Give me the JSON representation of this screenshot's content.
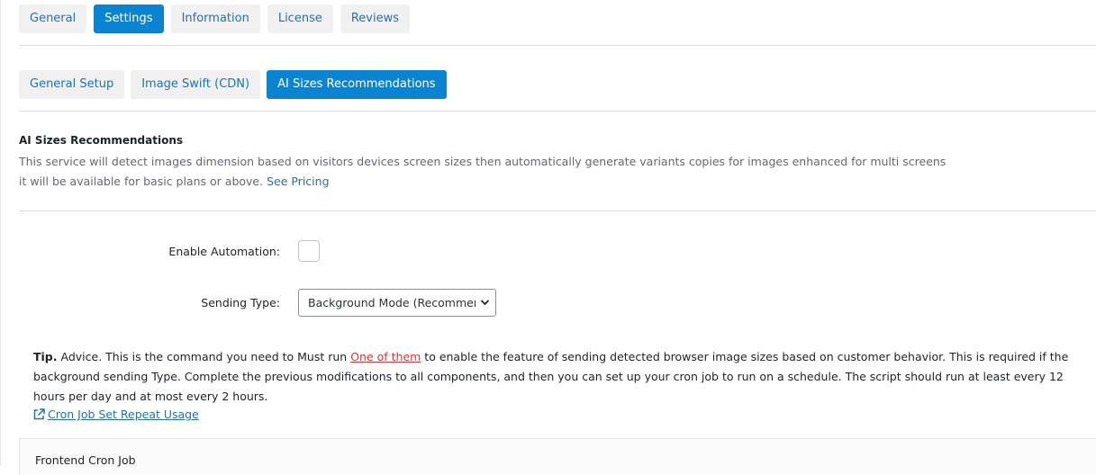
{
  "main_tabs": [
    {
      "label": "General",
      "active": false
    },
    {
      "label": "Settings",
      "active": true
    },
    {
      "label": "Information",
      "active": false
    },
    {
      "label": "License",
      "active": false
    },
    {
      "label": "Reviews",
      "active": false
    }
  ],
  "sub_tabs": [
    {
      "label": "General Setup",
      "active": false
    },
    {
      "label": "Image Swift (CDN)",
      "active": false
    },
    {
      "label": "AI Sizes Recommendations",
      "active": true
    }
  ],
  "section": {
    "title": "AI Sizes Recommendations",
    "description_line1": "This service will detect images dimension based on visitors devices screen sizes then automatically generate variants copies for images enhanced for multi screens",
    "description_line2": "it will be available for basic plans or above.",
    "pricing_link": "See Pricing"
  },
  "form": {
    "enable_automation_label": "Enable Automation:",
    "sending_type_label": "Sending Type:",
    "sending_type_value": "Background Mode (Recommended)"
  },
  "tip": {
    "label": "Tip.",
    "text_before": " Advice. This is the command you need to Must run ",
    "highlight": "One of them",
    "text_after": " to enable the feature of sending detected browser image sizes based on customer behavior. This is required if the background sending Type. Complete the previous modifications to all components, and then you can set up your cron job to run on a schedule. The script should run at least every 12 hours per day and at most every 2 hours."
  },
  "cron_link": "Cron Job Set Repeat Usage",
  "panel_title": "Frontend Cron Job",
  "icons": {
    "external_link": "external-link-icon",
    "select_chevron": "chevron-down-icon"
  },
  "colors": {
    "accent": "#0a84d1",
    "link": "#2271b1",
    "tab_bg": "#f0f0f1",
    "highlight_red": "#d63638"
  }
}
